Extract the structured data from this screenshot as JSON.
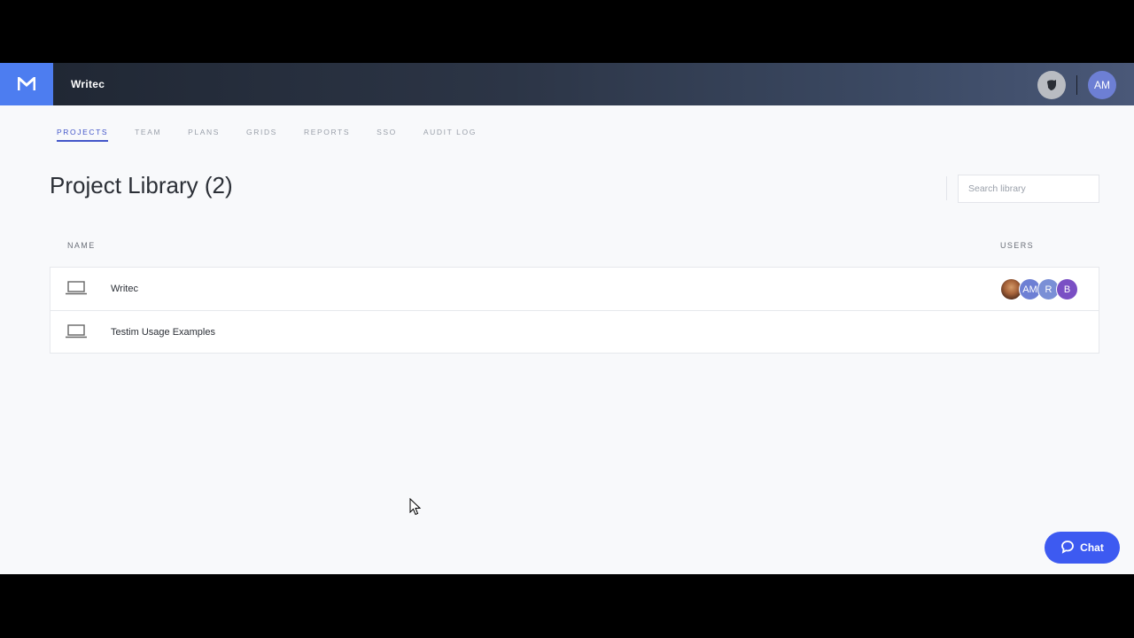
{
  "header": {
    "app_name": "Writec",
    "user_initials": "AM"
  },
  "nav": {
    "tabs": [
      {
        "label": "PROJECTS",
        "active": true
      },
      {
        "label": "TEAM"
      },
      {
        "label": "PLANS"
      },
      {
        "label": "GRIDS"
      },
      {
        "label": "REPORTS"
      },
      {
        "label": "SSO"
      },
      {
        "label": "AUDIT LOG"
      }
    ]
  },
  "library": {
    "title": "Project Library (2)",
    "search_placeholder": "Search library",
    "col_name": "NAME",
    "col_users": "USERS",
    "projects": [
      {
        "name": "Writec",
        "users": [
          "photo",
          "AM",
          "R",
          "B"
        ]
      },
      {
        "name": "Testim Usage Examples",
        "users": []
      }
    ]
  },
  "chat": {
    "label": "Chat"
  },
  "colors": {
    "accent": "#4356c9",
    "logo": "#4d7df0",
    "chat": "#3d5af1",
    "avatar_am": "#6d7fd4",
    "avatar_r": "#7a8fd6",
    "avatar_b": "#7a4fc4"
  }
}
